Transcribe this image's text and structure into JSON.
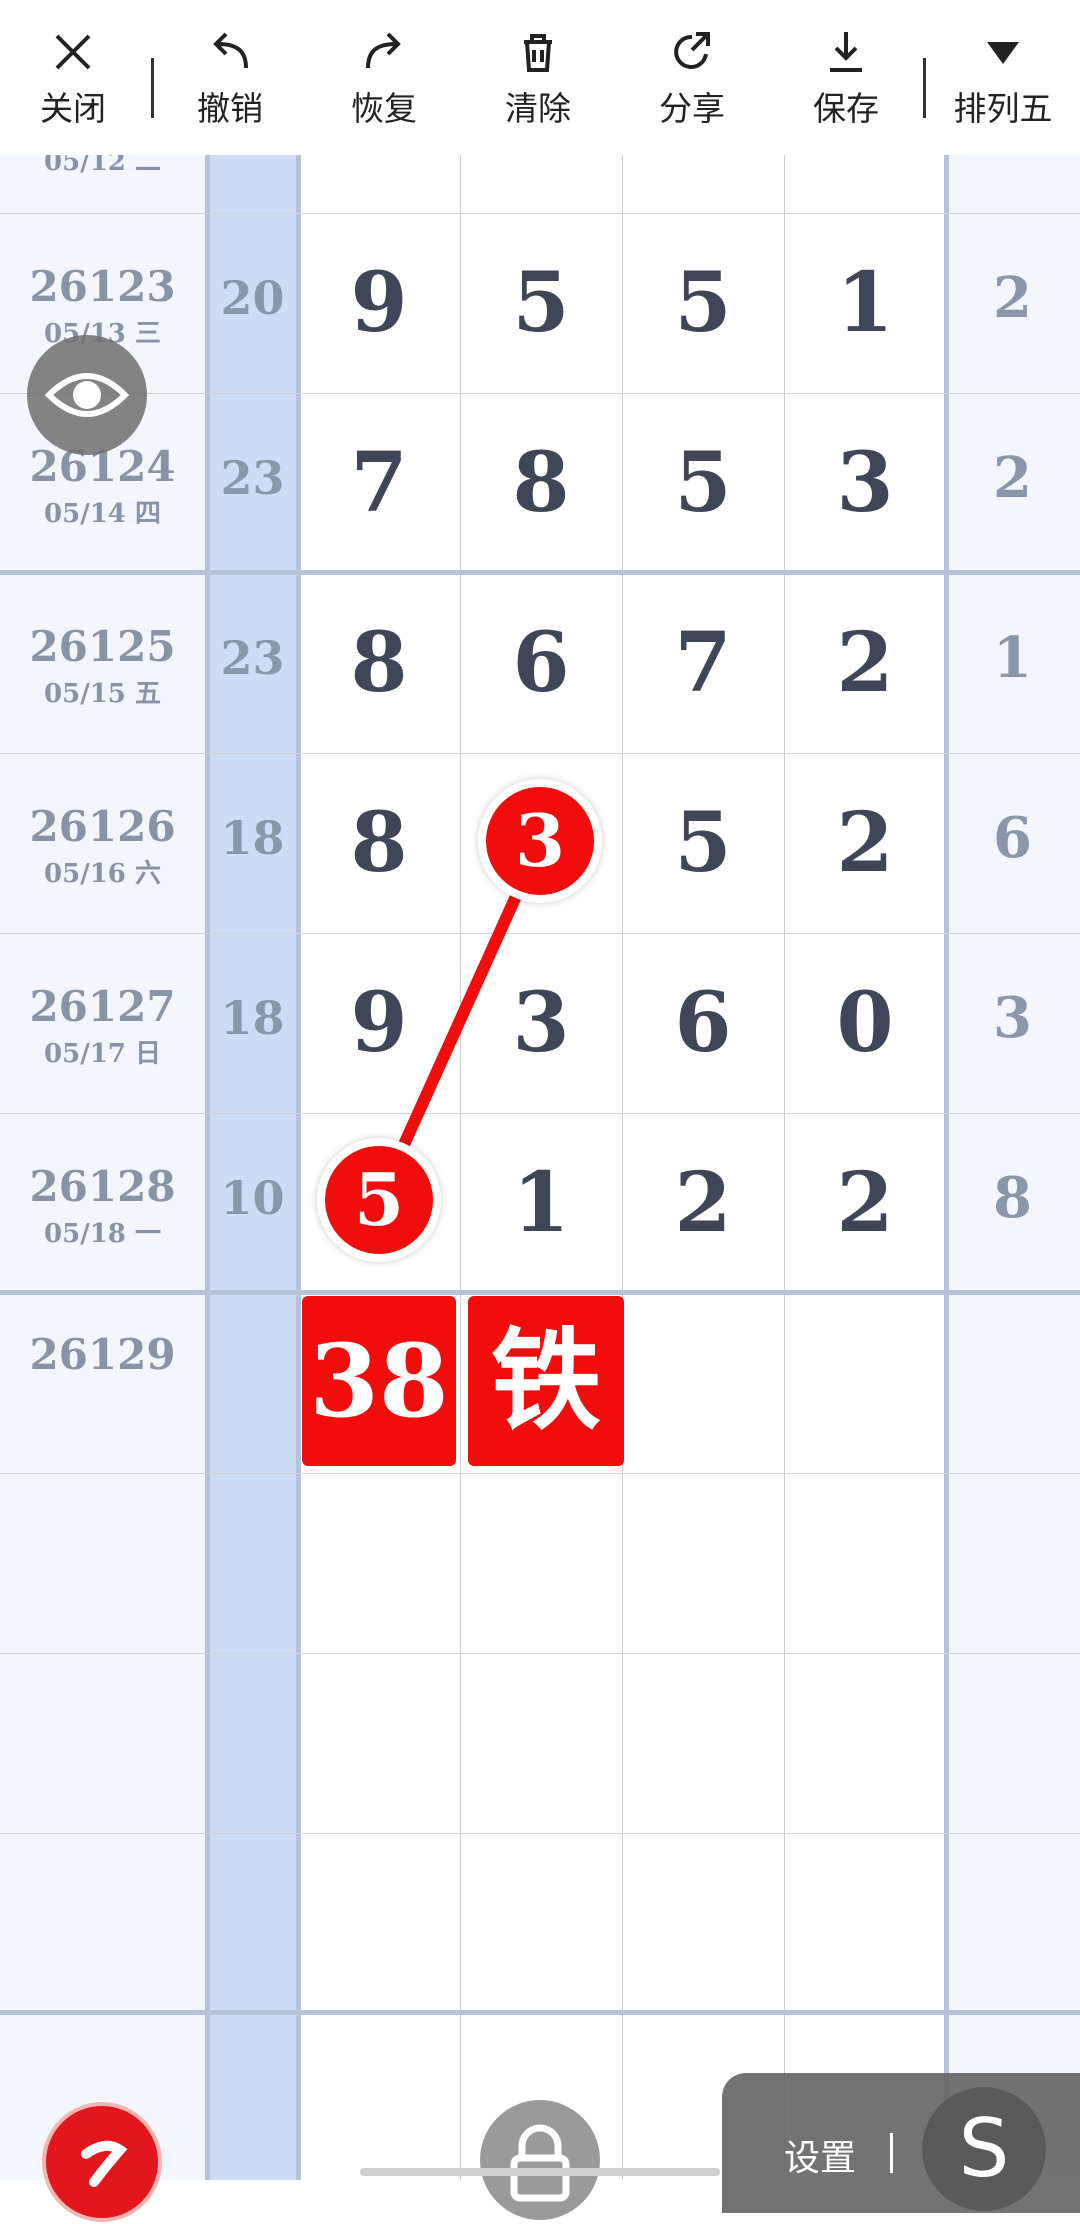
{
  "toolbar": {
    "close": "关闭",
    "undo": "撤销",
    "redo": "恢复",
    "clear": "清除",
    "share": "分享",
    "save": "保存",
    "sort": "排列五"
  },
  "partial_row": {
    "date": "05/12 二"
  },
  "rows": [
    {
      "issue": "26123",
      "date": "05/13 三",
      "sum": "20",
      "nums": [
        "9",
        "5",
        "5",
        "1"
      ],
      "right": "2"
    },
    {
      "issue": "26124",
      "date": "05/14 四",
      "sum": "23",
      "nums": [
        "7",
        "8",
        "5",
        "3"
      ],
      "right": "2"
    },
    {
      "issue": "26125",
      "date": "05/15 五",
      "sum": "23",
      "nums": [
        "8",
        "6",
        "7",
        "2"
      ],
      "right": "1"
    },
    {
      "issue": "26126",
      "date": "05/16 六",
      "sum": "18",
      "nums": [
        "8",
        "3",
        "5",
        "2"
      ],
      "right": "6"
    },
    {
      "issue": "26127",
      "date": "05/17 日",
      "sum": "18",
      "nums": [
        "9",
        "3",
        "6",
        "0"
      ],
      "right": "3"
    },
    {
      "issue": "26128",
      "date": "05/18 一",
      "sum": "10",
      "nums": [
        "5",
        "1",
        "2",
        "2"
      ],
      "right": "8"
    },
    {
      "issue": "26129"
    }
  ],
  "markers": {
    "circle_top": "3",
    "circle_bottom": "5",
    "box_num": "38",
    "box_char": "铁"
  },
  "settings_label": "设置",
  "colors": {
    "accent_red": "#f20d0d",
    "sum_column": "#cddcf4",
    "side_column": "#f3f6fd"
  }
}
